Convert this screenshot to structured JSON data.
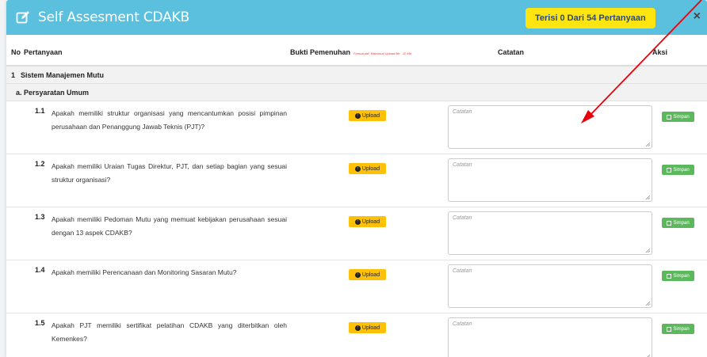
{
  "header": {
    "title": "Self Assesment CDAKB",
    "counter_prefix": "Terisi",
    "counter_filled": "0",
    "counter_suffix": "Dari 54 Pertanyaan",
    "close": "×"
  },
  "table": {
    "col_no": "No",
    "col_question": "Pertanyaan",
    "col_evidence": "Bukti Pemenuhan",
    "col_evidence_hint": "Format pdf, Maksimal Upload file : 10 Mb",
    "col_notes": "Catatan",
    "col_action": "Aksi"
  },
  "section": {
    "number": "1",
    "title": "Sistem Manajemen Mutu"
  },
  "subsection": {
    "title": "a. Persyaratan Umum"
  },
  "upload_label": "Upload",
  "save_label": "Simpan",
  "notes_placeholder": "Catatan",
  "rows": [
    {
      "num": "1.1",
      "text": "Apakah memiliki struktur organisasi yang mencantumkan posisi pimpinan perusahaan dan Penanggung Jawab Teknis (PJT)?"
    },
    {
      "num": "1.2",
      "text": "Apakah memiliki Uraian Tugas Direktur, PJT, dan setiap bagian yang sesuai struktur organisasi?"
    },
    {
      "num": "1.3",
      "text": "Apakah memiliki Pedoman Mutu yang memuat kebijakan perusahaan sesuai dengan 13 aspek CDAKB?"
    },
    {
      "num": "1.4",
      "text": "Apakah memiliki Perencanaan dan Monitoring Sasaran Mutu?"
    },
    {
      "num": "1.5",
      "text": "Apakah PJT memiliki sertifikat pelatihan CDAKB yang diterbitkan oleh Kemenkes?"
    }
  ],
  "colors": {
    "header_bg": "#5bc0de",
    "counter_bg": "#ffe50f",
    "upload_bg": "#ffc107",
    "save_bg": "#5cb85c",
    "arrow": "#e8000a"
  }
}
